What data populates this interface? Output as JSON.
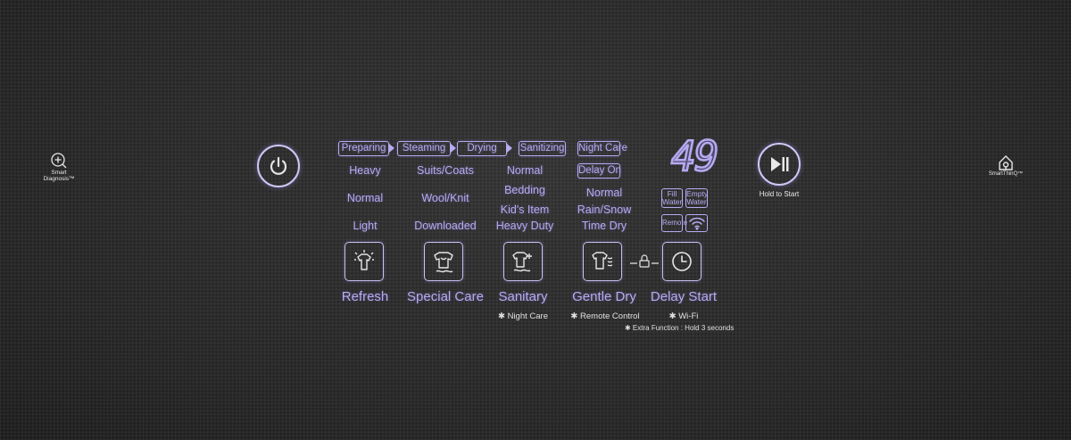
{
  "smart_diagnosis": {
    "label_line1": "Smart",
    "label_line2": "Diagnosis™"
  },
  "smartthinq": {
    "label": "SmartThinQ™"
  },
  "power": {
    "icon": "power-icon"
  },
  "stages": [
    "Preparing",
    "Steaming",
    "Drying",
    "Sanitizing"
  ],
  "night_care": "Night Care",
  "delay_on": "Delay On",
  "display_digits": "49",
  "indicators": {
    "fill_water": "Fill Water",
    "empty_water": "Empty Water",
    "remote": "Remote",
    "wifi_icon": "wifi-icon"
  },
  "refresh_options": [
    "Heavy",
    "Normal",
    "Light"
  ],
  "special_care_options": [
    "Suits/Coats",
    "Wool/Knit",
    "Downloaded"
  ],
  "sanitary_options": [
    "Normal",
    "Bedding",
    "Kid's Item",
    "Heavy Duty"
  ],
  "gentle_dry_options": [
    "Normal",
    "Rain/Snow",
    "Time Dry"
  ],
  "cycles": [
    {
      "name": "Refresh",
      "icon": "refresh-icon",
      "note": ""
    },
    {
      "name": "Special Care",
      "icon": "special-care-icon",
      "note": ""
    },
    {
      "name": "Sanitary",
      "icon": "sanitary-icon",
      "note": "✱ Night Care"
    },
    {
      "name": "Gentle Dry",
      "icon": "gentle-dry-icon",
      "note": "✱ Remote Control"
    },
    {
      "name": "Delay Start",
      "icon": "clock-icon",
      "note": "✱ Wi-Fi"
    }
  ],
  "lock_icon": "child-lock-icon",
  "extra_function": "✱ Extra Function : Hold 3 seconds",
  "start": {
    "icon": "play-pause-icon",
    "label": "Hold to Start"
  }
}
